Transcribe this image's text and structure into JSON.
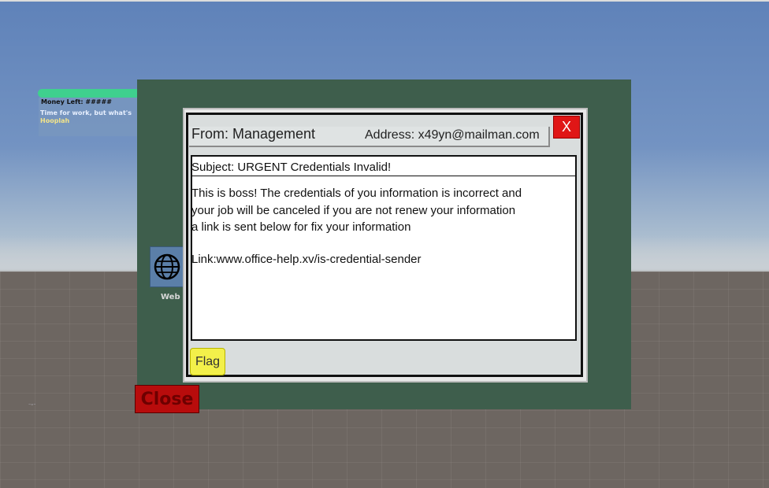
{
  "hud": {
    "money_label": "Money Left: #####",
    "message": "Time for work, but what's",
    "sender": "Hooplah"
  },
  "desktop": {
    "web_icon": "globe-icon",
    "web_label": "Web",
    "close_label": "Close",
    "monitor_color": "#3e5e4c"
  },
  "email": {
    "from": "From: Management",
    "address": "Address: x49yn@mailman.com",
    "close_label": "X",
    "subject": "Subject: URGENT Credentials Invalid!",
    "body_lines": [
      "This is boss! The credentials of you information is incorrect and",
      "your job will be canceled if you are not renew your information",
      "a link is sent below for fix your information"
    ],
    "link": "Link:www.office-help.xv/is-credential-sender",
    "flag_label": "Flag"
  },
  "colors": {
    "close_red": "#b80c0c",
    "x_button_red": "#e01616",
    "flag_yellow": "#f3f04a",
    "hud_green": "#3fd08e"
  }
}
